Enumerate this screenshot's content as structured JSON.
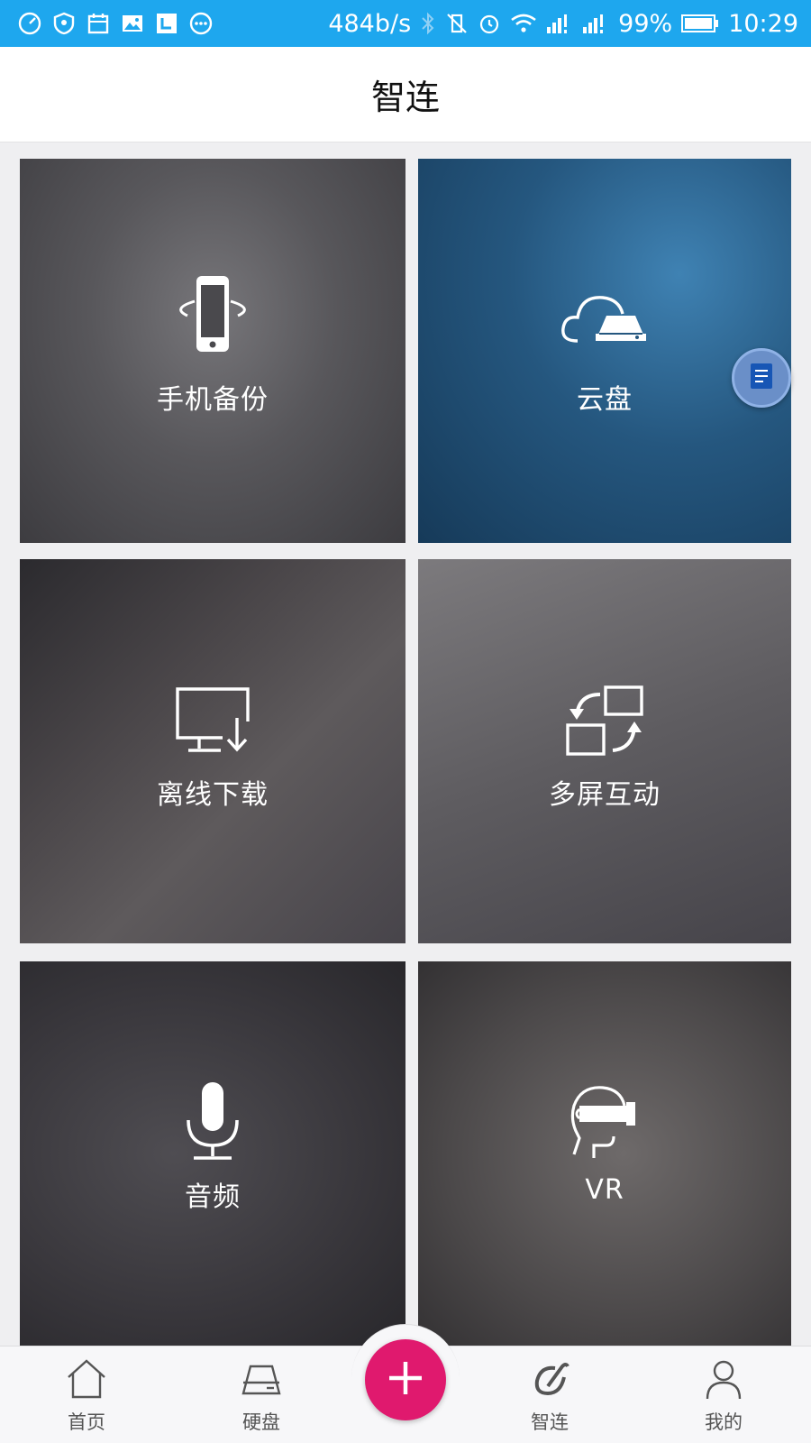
{
  "status_bar": {
    "left_icons": [
      "speed-icon",
      "shield-icon",
      "calendar-icon",
      "image-icon",
      "app-icon",
      "more-icon"
    ],
    "network_speed": "484b/s",
    "battery": "99%",
    "time": "10:29"
  },
  "header": {
    "title": "智连"
  },
  "tiles": [
    {
      "label": "手机备份",
      "icon": "phone-rotate-icon"
    },
    {
      "label": "云盘",
      "icon": "cloud-drive-icon"
    },
    {
      "label": "离线下载",
      "icon": "monitor-download-icon"
    },
    {
      "label": "多屏互动",
      "icon": "screen-switch-icon"
    },
    {
      "label": "音频",
      "icon": "microphone-icon"
    },
    {
      "label": "VR",
      "icon": "vr-headset-icon"
    }
  ],
  "bottom_nav": {
    "items": [
      {
        "label": "首页",
        "icon": "home-icon"
      },
      {
        "label": "硬盘",
        "icon": "harddisk-icon"
      },
      {
        "label": "智连",
        "icon": "link-icon"
      },
      {
        "label": "我的",
        "icon": "user-icon"
      }
    ],
    "fab_icon": "plus-icon"
  },
  "colors": {
    "status_bar": "#1ea7ee",
    "fab": "#e0196e",
    "float_button": "#6a8fc8"
  }
}
